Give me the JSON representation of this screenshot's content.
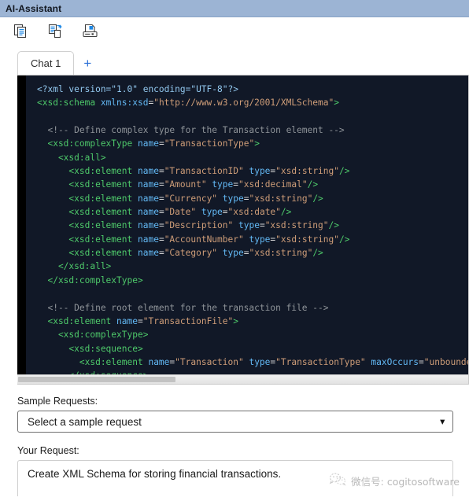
{
  "window": {
    "title": "AI-Assistant"
  },
  "toolbar": {
    "buttons": [
      {
        "name": "copy-icon",
        "label": "Copy"
      },
      {
        "name": "export-document-icon",
        "label": "Export"
      },
      {
        "name": "save-to-disk-icon",
        "label": "Save"
      }
    ]
  },
  "tabs": {
    "items": [
      {
        "label": "Chat 1",
        "active": true
      }
    ],
    "add_label": "+"
  },
  "code": {
    "language": "xml",
    "lines": [
      [
        {
          "t": "decl",
          "s": "<?xml version=\"1.0\" encoding=\"UTF-8\"?>"
        }
      ],
      [
        {
          "t": "tag",
          "s": "<xsd:schema "
        },
        {
          "t": "attr",
          "s": "xmlns:xsd"
        },
        {
          "t": "punct",
          "s": "="
        },
        {
          "t": "str",
          "s": "\"http://www.w3.org/2001/XMLSchema\""
        },
        {
          "t": "tag",
          "s": ">"
        }
      ],
      [],
      [
        {
          "t": "com",
          "s": "  <!-- Define complex type for the Transaction element -->"
        }
      ],
      [
        {
          "t": "tag",
          "s": "  <xsd:complexType "
        },
        {
          "t": "attr",
          "s": "name"
        },
        {
          "t": "punct",
          "s": "="
        },
        {
          "t": "str",
          "s": "\"TransactionType\""
        },
        {
          "t": "tag",
          "s": ">"
        }
      ],
      [
        {
          "t": "tag",
          "s": "    <xsd:all>"
        }
      ],
      [
        {
          "t": "tag",
          "s": "      <xsd:element "
        },
        {
          "t": "attr",
          "s": "name"
        },
        {
          "t": "punct",
          "s": "="
        },
        {
          "t": "str",
          "s": "\"TransactionID\" "
        },
        {
          "t": "attr",
          "s": "type"
        },
        {
          "t": "punct",
          "s": "="
        },
        {
          "t": "str",
          "s": "\"xsd:string\""
        },
        {
          "t": "tag",
          "s": "/>"
        }
      ],
      [
        {
          "t": "tag",
          "s": "      <xsd:element "
        },
        {
          "t": "attr",
          "s": "name"
        },
        {
          "t": "punct",
          "s": "="
        },
        {
          "t": "str",
          "s": "\"Amount\" "
        },
        {
          "t": "attr",
          "s": "type"
        },
        {
          "t": "punct",
          "s": "="
        },
        {
          "t": "str",
          "s": "\"xsd:decimal\""
        },
        {
          "t": "tag",
          "s": "/>"
        }
      ],
      [
        {
          "t": "tag",
          "s": "      <xsd:element "
        },
        {
          "t": "attr",
          "s": "name"
        },
        {
          "t": "punct",
          "s": "="
        },
        {
          "t": "str",
          "s": "\"Currency\" "
        },
        {
          "t": "attr",
          "s": "type"
        },
        {
          "t": "punct",
          "s": "="
        },
        {
          "t": "str",
          "s": "\"xsd:string\""
        },
        {
          "t": "tag",
          "s": "/>"
        }
      ],
      [
        {
          "t": "tag",
          "s": "      <xsd:element "
        },
        {
          "t": "attr",
          "s": "name"
        },
        {
          "t": "punct",
          "s": "="
        },
        {
          "t": "str",
          "s": "\"Date\" "
        },
        {
          "t": "attr",
          "s": "type"
        },
        {
          "t": "punct",
          "s": "="
        },
        {
          "t": "str",
          "s": "\"xsd:date\""
        },
        {
          "t": "tag",
          "s": "/>"
        }
      ],
      [
        {
          "t": "tag",
          "s": "      <xsd:element "
        },
        {
          "t": "attr",
          "s": "name"
        },
        {
          "t": "punct",
          "s": "="
        },
        {
          "t": "str",
          "s": "\"Description\" "
        },
        {
          "t": "attr",
          "s": "type"
        },
        {
          "t": "punct",
          "s": "="
        },
        {
          "t": "str",
          "s": "\"xsd:string\""
        },
        {
          "t": "tag",
          "s": "/>"
        }
      ],
      [
        {
          "t": "tag",
          "s": "      <xsd:element "
        },
        {
          "t": "attr",
          "s": "name"
        },
        {
          "t": "punct",
          "s": "="
        },
        {
          "t": "str",
          "s": "\"AccountNumber\" "
        },
        {
          "t": "attr",
          "s": "type"
        },
        {
          "t": "punct",
          "s": "="
        },
        {
          "t": "str",
          "s": "\"xsd:string\""
        },
        {
          "t": "tag",
          "s": "/>"
        }
      ],
      [
        {
          "t": "tag",
          "s": "      <xsd:element "
        },
        {
          "t": "attr",
          "s": "name"
        },
        {
          "t": "punct",
          "s": "="
        },
        {
          "t": "str",
          "s": "\"Category\" "
        },
        {
          "t": "attr",
          "s": "type"
        },
        {
          "t": "punct",
          "s": "="
        },
        {
          "t": "str",
          "s": "\"xsd:string\""
        },
        {
          "t": "tag",
          "s": "/>"
        }
      ],
      [
        {
          "t": "tag",
          "s": "    </xsd:all>"
        }
      ],
      [
        {
          "t": "tag",
          "s": "  </xsd:complexType>"
        }
      ],
      [],
      [
        {
          "t": "com",
          "s": "  <!-- Define root element for the transaction file -->"
        }
      ],
      [
        {
          "t": "tag",
          "s": "  <xsd:element "
        },
        {
          "t": "attr",
          "s": "name"
        },
        {
          "t": "punct",
          "s": "="
        },
        {
          "t": "str",
          "s": "\"TransactionFile\""
        },
        {
          "t": "tag",
          "s": ">"
        }
      ],
      [
        {
          "t": "tag",
          "s": "    <xsd:complexType>"
        }
      ],
      [
        {
          "t": "tag",
          "s": "      <xsd:sequence>"
        }
      ],
      [
        {
          "t": "tag",
          "s": "        <xsd:element "
        },
        {
          "t": "attr",
          "s": "name"
        },
        {
          "t": "punct",
          "s": "="
        },
        {
          "t": "str",
          "s": "\"Transaction\" "
        },
        {
          "t": "attr",
          "s": "type"
        },
        {
          "t": "punct",
          "s": "="
        },
        {
          "t": "str",
          "s": "\"TransactionType\" "
        },
        {
          "t": "attr",
          "s": "maxOccurs"
        },
        {
          "t": "punct",
          "s": "="
        },
        {
          "t": "str",
          "s": "\"unbounded\""
        },
        {
          "t": "tag",
          "s": "/>"
        }
      ],
      [
        {
          "t": "tag",
          "s": "      </xsd:sequence>"
        }
      ]
    ]
  },
  "form": {
    "sample_requests_label": "Sample Requests:",
    "sample_requests_value": "Select a sample request",
    "your_request_label": "Your Request:",
    "your_request_value": "Create XML Schema for storing financial transactions."
  },
  "watermark": {
    "text": "微信号: cogitosoftware"
  },
  "colors": {
    "titlebar": "#9cb4d4",
    "code_background": "#111827",
    "accent": "#2a6fd6",
    "tag": "#4ec96a",
    "attr": "#63b9f5",
    "string": "#ce9d78",
    "comment": "#8f9499"
  }
}
